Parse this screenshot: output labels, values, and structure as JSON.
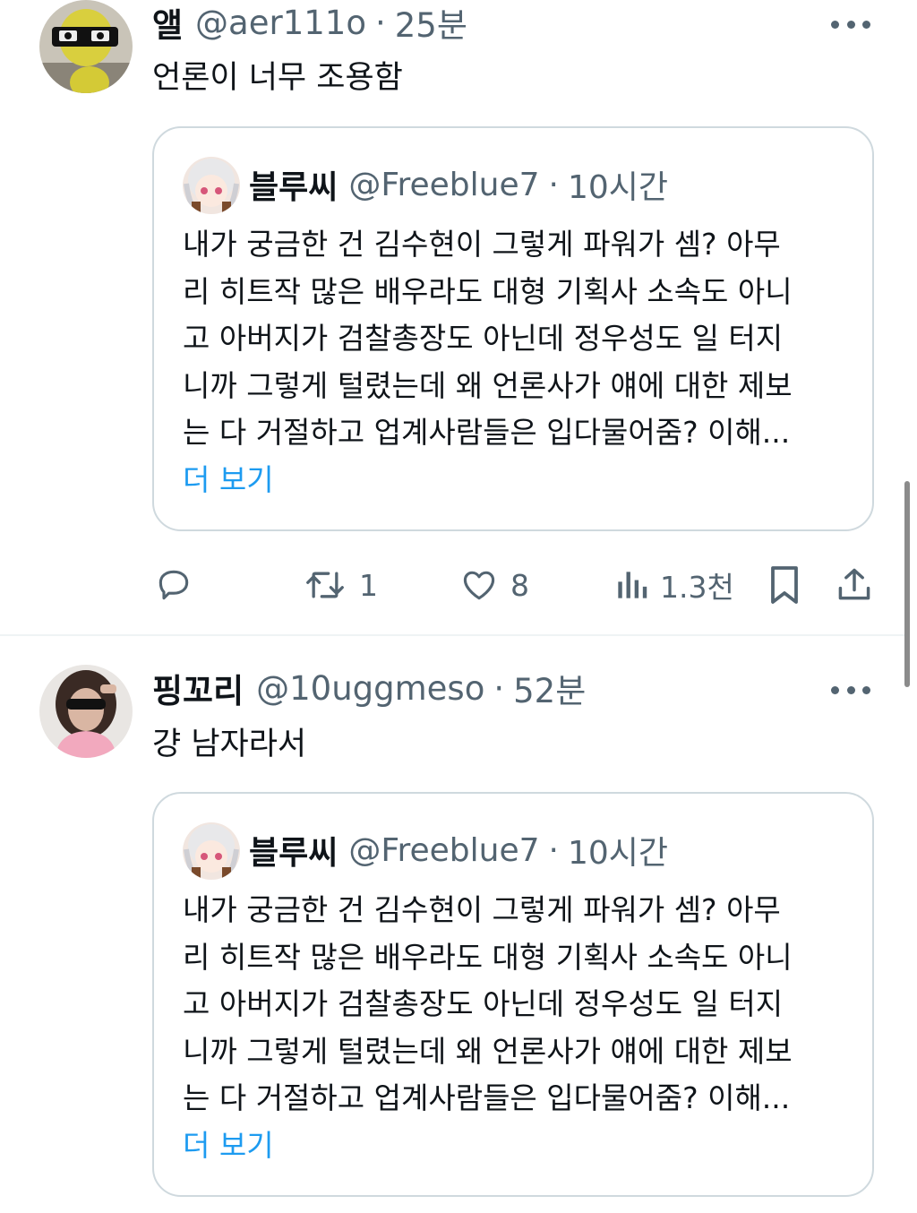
{
  "tweets": [
    {
      "display_name": "앨",
      "handle": "@aer111o",
      "separator": "·",
      "time": "25분",
      "text": "언론이 너무 조용함",
      "quote": {
        "display_name": "블루씨",
        "handle": "@Freeblue7",
        "separator": "·",
        "time": "10시간",
        "lines": [
          "내가 궁금한 건 김수현이 그렇게 파워가 셈? 아무",
          "리 히트작 많은 배우라도 대형 기획사 소속도 아니",
          "고 아버지가 검찰총장도 아닌데 정우성도 일 터지",
          "니까 그렇게 털렸는데 왜 언론사가 얘에 대한 제보",
          "는 다 거절하고 업계사람들은 입다물어줌? 이해..."
        ],
        "show_more": "더 보기"
      },
      "actions": {
        "reply_count": "",
        "retweet_count": "1",
        "like_count": "8",
        "view_count": "1.3천"
      }
    },
    {
      "display_name": "핑꼬리",
      "handle": "@10uggmeso",
      "separator": "·",
      "time": "52분",
      "text": "걍 남자라서",
      "quote": {
        "display_name": "블루씨",
        "handle": "@Freeblue7",
        "separator": "·",
        "time": "10시간",
        "lines": [
          "내가 궁금한 건 김수현이 그렇게 파워가 셈? 아무",
          "리 히트작 많은 배우라도 대형 기획사 소속도 아니",
          "고 아버지가 검찰총장도 아닌데 정우성도 일 터지",
          "니까 그렇게 털렸는데 왜 언론사가 얘에 대한 제보",
          "는 다 거절하고 업계사람들은 입다물어줌? 이해..."
        ],
        "show_more": "더 보기"
      }
    }
  ],
  "colors": {
    "text_primary": "#0f1419",
    "text_secondary": "#536471",
    "link": "#1d9bf0",
    "border": "#cfd9de",
    "divider": "#eff3f4"
  },
  "icons": {
    "reply": "reply-icon",
    "retweet": "retweet-icon",
    "like": "heart-icon",
    "views": "views-icon",
    "bookmark": "bookmark-icon",
    "share": "share-icon",
    "more": "more-icon"
  }
}
